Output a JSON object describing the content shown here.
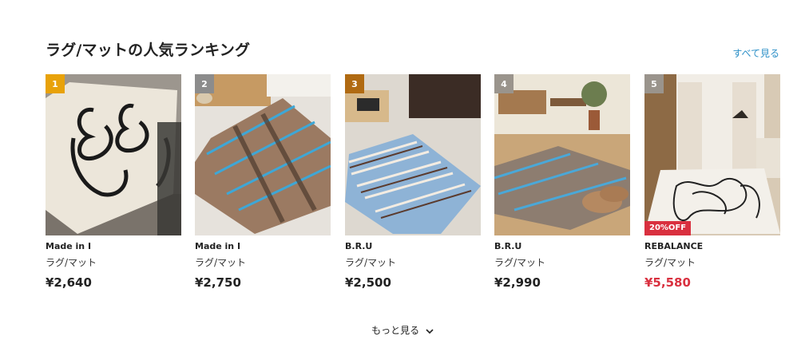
{
  "section": {
    "title": "ラグ/マットの人気ランキング",
    "see_all": "すべて見る",
    "more_label": "もっと見る"
  },
  "colors": {
    "link": "#2b8fc7",
    "sale": "#d9303f",
    "rank_gold": "#e8a20a",
    "rank_silver": "#8c8c8c",
    "rank_bronze": "#b06a12",
    "rank_other": "#9a948c"
  },
  "products": [
    {
      "rank": "1",
      "brand": "Made in I",
      "category": "ラグ/マット",
      "price": "¥2,640",
      "badge": "",
      "sale": false,
      "image": "cream-heart-rug"
    },
    {
      "rank": "2",
      "brand": "Made in I",
      "category": "ラグ/マット",
      "price": "¥2,750",
      "badge": "",
      "sale": false,
      "image": "brown-blue-plaid-rug"
    },
    {
      "rank": "3",
      "brand": "B.R.U",
      "category": "ラグ/マット",
      "price": "¥2,500",
      "badge": "",
      "sale": false,
      "image": "blue-stripe-rug"
    },
    {
      "rank": "4",
      "brand": "B.R.U",
      "category": "ラグ/マット",
      "price": "¥2,990",
      "badge": "",
      "sale": false,
      "image": "plaid-rug-room"
    },
    {
      "rank": "5",
      "brand": "REBALANCE",
      "category": "ラグ/マット",
      "price": "¥5,580",
      "badge": "20%OFF",
      "sale": true,
      "image": "line-art-rug-living-room"
    }
  ]
}
